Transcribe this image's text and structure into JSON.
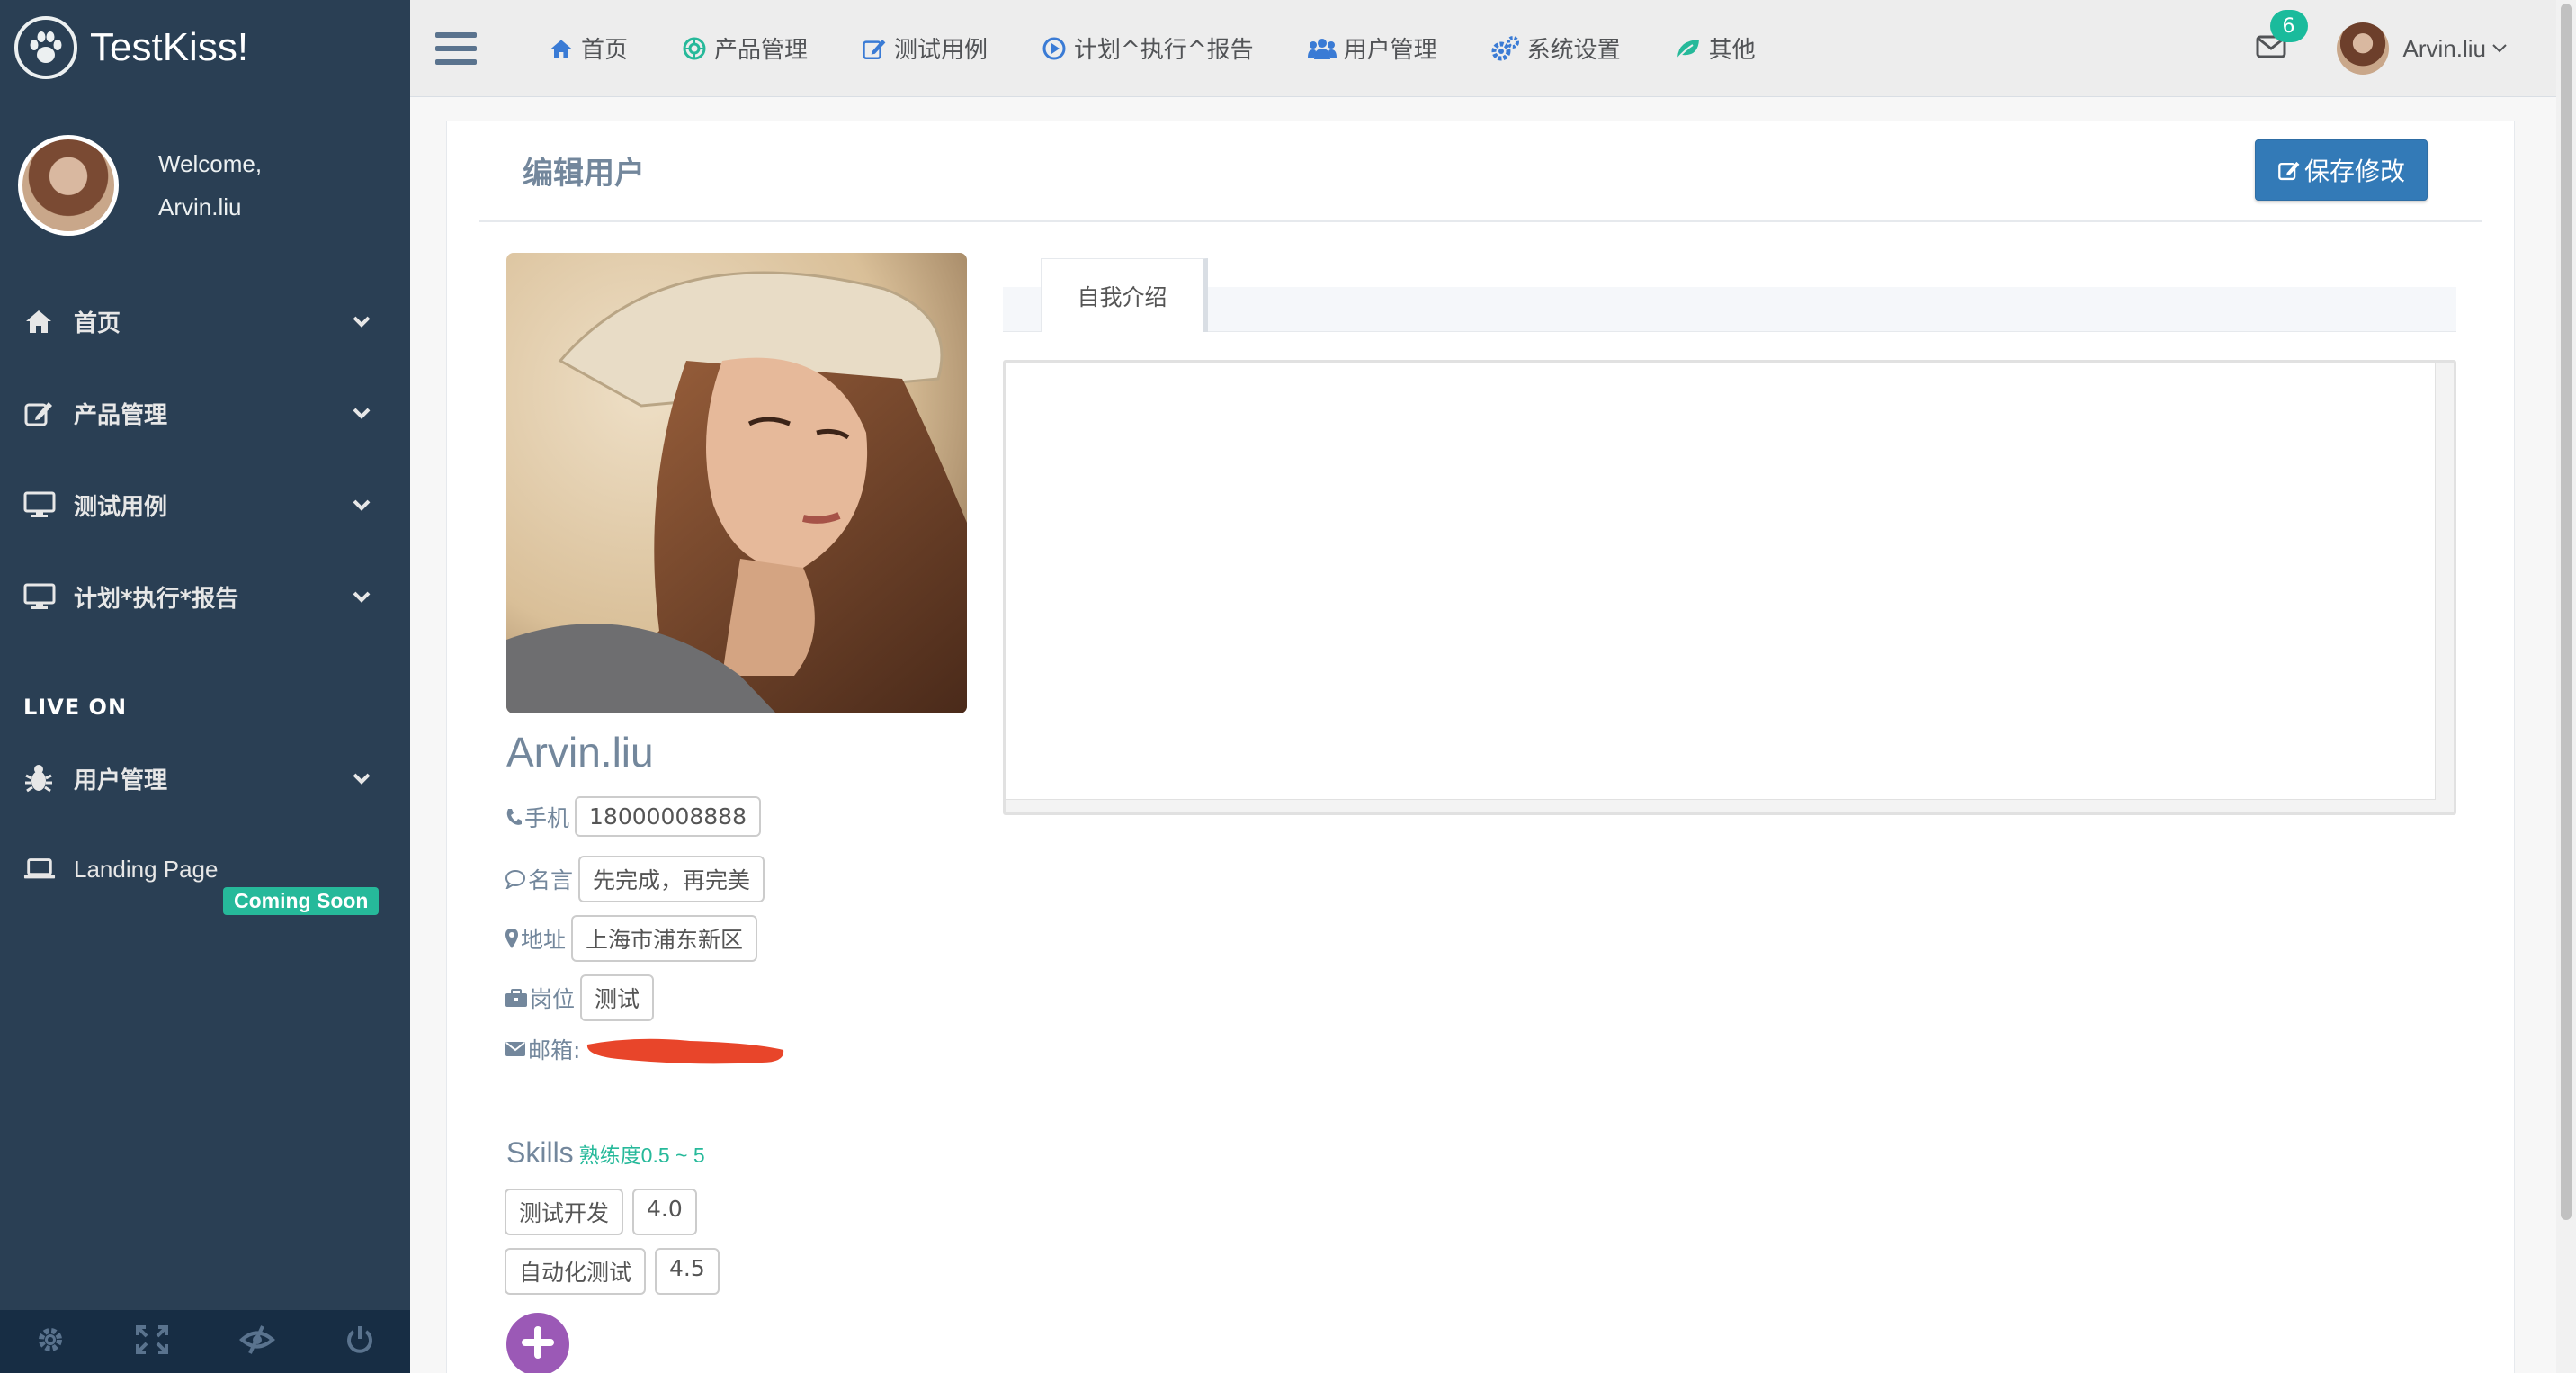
{
  "brand": {
    "name": "TestKiss!"
  },
  "profile": {
    "welcome": "Welcome,",
    "username": "Arvin.liu"
  },
  "sidebar": {
    "items": [
      {
        "label": "首页",
        "icon": "home-icon"
      },
      {
        "label": "产品管理",
        "icon": "edit-icon"
      },
      {
        "label": "测试用例",
        "icon": "desktop-icon"
      },
      {
        "label": "计划*执行*报告",
        "icon": "desktop-icon"
      }
    ],
    "section_title": "LIVE ON",
    "live_items": [
      {
        "label": "用户管理",
        "icon": "bug-icon"
      }
    ],
    "landing": {
      "label": "Landing Page",
      "badge": "Coming Soon"
    },
    "footer_icons": [
      "gear-icon",
      "fullscreen-icon",
      "eye-slash-icon",
      "power-icon"
    ]
  },
  "topnav": {
    "items": [
      {
        "label": "首页",
        "icon": "home-icon"
      },
      {
        "label": "产品管理",
        "icon": "gear-flower-icon"
      },
      {
        "label": "测试用例",
        "icon": "edit-icon"
      },
      {
        "label": "计划^执行^报告",
        "icon": "play-circle-icon"
      },
      {
        "label": "用户管理",
        "icon": "users-icon"
      },
      {
        "label": "系统设置",
        "icon": "cogs-icon"
      },
      {
        "label": "其他",
        "icon": "leaf-icon"
      }
    ],
    "mail_count": "6",
    "user": "Arvin.liu"
  },
  "panel": {
    "title": "编辑用户",
    "save_label": "保存修改"
  },
  "user": {
    "name": "Arvin.liu",
    "phone_label": "手机",
    "phone": "18000008888",
    "motto_label": "名言",
    "motto": "先完成，再完美",
    "address_label": "地址",
    "address": "上海市浦东新区",
    "position_label": "岗位",
    "position": "测试",
    "email_label": "邮箱:"
  },
  "skills": {
    "title": "Skills",
    "subtitle": "熟练度0.5 ~ 5",
    "items": [
      {
        "name": "测试开发",
        "level": "4.0"
      },
      {
        "name": "自动化测试",
        "level": "4.5"
      }
    ]
  },
  "tabs": [
    {
      "label": "自我介绍"
    }
  ],
  "colors": {
    "sidebar": "#2A3F54",
    "accent_green": "#26B99A",
    "primary_blue": "#337AB7",
    "add_purple": "#9B59B6",
    "nav_icon_blue": "#3A7BD5"
  }
}
